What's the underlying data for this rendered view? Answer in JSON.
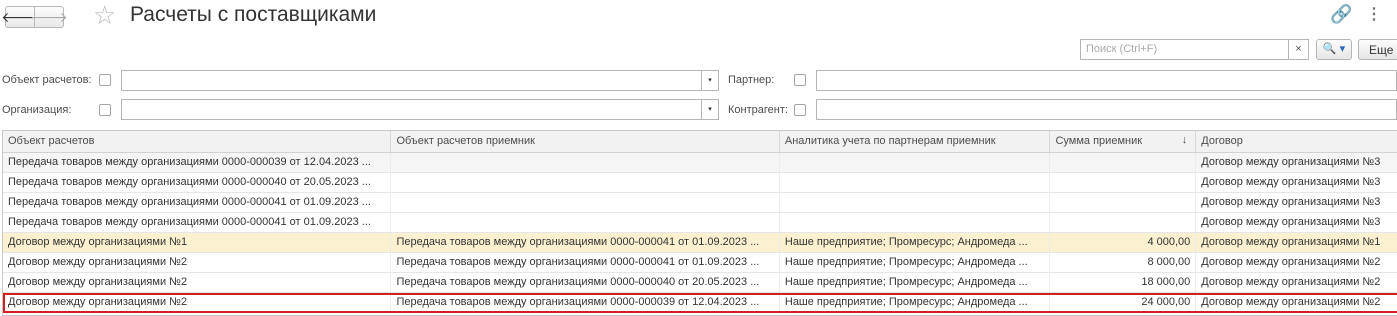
{
  "window": {
    "title": "Расчеты с поставщиками",
    "back_icon": "🡐",
    "forward_icon": "🡒",
    "star_icon": "☆",
    "link_icon": "🔗",
    "more_icon": "⋮"
  },
  "search": {
    "placeholder": "Поиск (Ctrl+F)",
    "clear_icon": "×",
    "search_button_label": "🔍 ▾",
    "more_label": "Еще"
  },
  "filters": {
    "settlement_object_label": "Объект расчетов:",
    "organization_label": "Организация:",
    "partner_label": "Партнер:",
    "counterparty_label": "Контрагент:",
    "dropdown_icon": "▾"
  },
  "table": {
    "columns": [
      "Объект расчетов",
      "Объект расчетов приемник",
      "Аналитика учета по партнерам приемник",
      "Сумма приемник",
      "Договор"
    ],
    "sort_icon": "↓",
    "rows": [
      {
        "c1": "Передача товаров между организациями 0000-000039 от 12.04.2023 ...",
        "c2": "",
        "c3": "",
        "c4": "",
        "c5": "Договор между организациями №3"
      },
      {
        "c1": "Передача товаров между организациями 0000-000040 от 20.05.2023 ...",
        "c2": "",
        "c3": "",
        "c4": "",
        "c5": "Договор между организациями №3"
      },
      {
        "c1": "Передача товаров между организациями 0000-000041 от 01.09.2023 ...",
        "c2": "",
        "c3": "",
        "c4": "",
        "c5": "Договор между организациями №3"
      },
      {
        "c1": "Передача товаров между организациями 0000-000041 от 01.09.2023 ...",
        "c2": "",
        "c3": "",
        "c4": "",
        "c5": "Договор между организациями №3"
      },
      {
        "c1": "Договор между организациями №1",
        "c2": "Передача товаров между организациями 0000-000041 от 01.09.2023 ...",
        "c3": "Наше предприятие; Промресурс; Андромеда ...",
        "c4": "4 000,00",
        "c5": "Договор между организациями №1"
      },
      {
        "c1": "Договор между организациями №2",
        "c2": "Передача товаров между организациями 0000-000041 от 01.09.2023 ...",
        "c3": "Наше предприятие; Промресурс; Андромеда ...",
        "c4": "8 000,00",
        "c5": "Договор между организациями №2"
      },
      {
        "c1": "Договор между организациями №2",
        "c2": "Передача товаров между организациями 0000-000040 от 20.05.2023 ...",
        "c3": "Наше предприятие; Промресурс; Андромеда ...",
        "c4": "18 000,00",
        "c5": "Договор между организациями №2"
      },
      {
        "c1": "Договор между организациями №2",
        "c2": "Передача товаров между организациями 0000-000039 от 12.04.2023 ...",
        "c3": "Наше предприятие; Промресурс; Андромеда ...",
        "c4": "24 000,00",
        "c5": "Договор между организациями №2"
      }
    ]
  },
  "colors": {
    "selected_row": "#fbf0cf",
    "current_row_outline": "#d21f1f",
    "header_bg": "#f2f2f2"
  }
}
